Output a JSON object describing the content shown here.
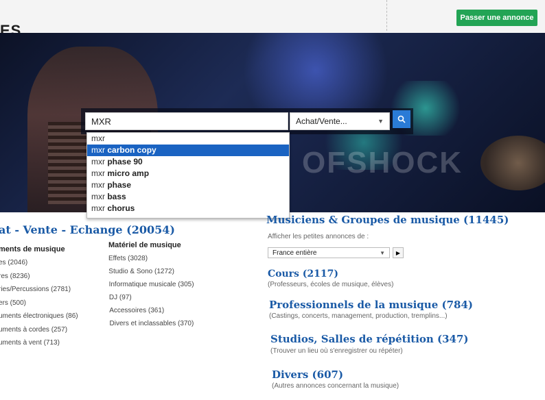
{
  "header": {
    "site_title": "ES",
    "post_button": "Passer une annonce"
  },
  "search": {
    "query": "MXR",
    "category_select": "Achat/Vente...",
    "suggestions": [
      {
        "prefix": "mxr",
        "rest": "",
        "active": false
      },
      {
        "prefix": "mxr",
        "rest": "carbon copy",
        "active": true
      },
      {
        "prefix": "mxr",
        "rest": "phase 90",
        "active": false
      },
      {
        "prefix": "mxr",
        "rest": "micro amp",
        "active": false
      },
      {
        "prefix": "mxr",
        "rest": "phase",
        "active": false
      },
      {
        "prefix": "mxr",
        "rest": "bass",
        "active": false
      },
      {
        "prefix": "mxr",
        "rest": "chorus",
        "active": false
      }
    ]
  },
  "hero": {
    "stage_text": "OFSHOCK"
  },
  "achat": {
    "title": "at - Vente - Echange (20054)",
    "col1_head": "ments de musique",
    "col1_items": [
      "es (2046)",
      "res (8236)",
      "ries/Percussions (2781)",
      "ers (500)",
      "uments électroniques (86)",
      "uments à cordes (257)",
      "uments à vent (713)"
    ],
    "col2_head": "Matériel de musique",
    "col2_items": [
      "Effets (3028)",
      "Studio & Sono (1272)",
      "Informatique musicale (305)",
      "DJ (97)",
      "Accessoires (361)",
      "Divers et inclassables (370)"
    ]
  },
  "musiciens": {
    "title": "Musiciens & Groupes de musique (11445)",
    "filter_label": "Afficher les petites annonces de :",
    "region_value": "France entière"
  },
  "sections": [
    {
      "title": "Cours (2117)",
      "desc": "(Professeurs, écoles de musique, élèves)"
    },
    {
      "title": "Professionnels de la musique (784)",
      "desc": "(Castings, concerts, management, production, tremplins...)"
    },
    {
      "title": "Studios, Salles de répétition (347)",
      "desc": "(Trouver un lieu où s'enregistrer ou répéter)"
    },
    {
      "title": "Divers (607)",
      "desc": "(Autres annonces concernant la musique)"
    }
  ]
}
